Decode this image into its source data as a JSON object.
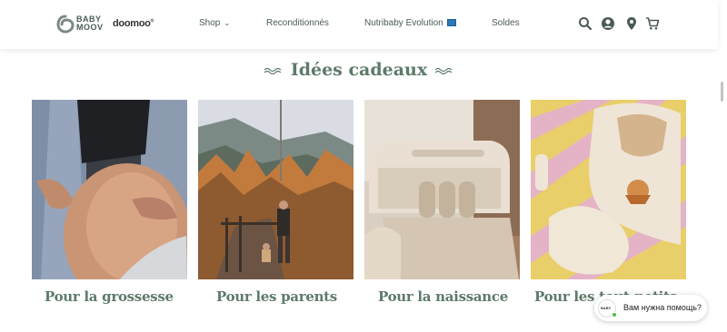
{
  "header": {
    "logo_text_line1": "BABY",
    "logo_text_line2": "MOOV",
    "doomoo_label": "doomoo",
    "nav": [
      {
        "label": "Shop"
      },
      {
        "label": "Reconditionnés"
      },
      {
        "label": "Nutribaby Evolution"
      },
      {
        "label": "Soldes"
      }
    ],
    "icons": [
      "search-icon",
      "account-icon",
      "location-pin-icon",
      "cart-icon"
    ]
  },
  "section": {
    "title": "Idées cadeaux"
  },
  "cards": [
    {
      "label": "Pour la grossesse"
    },
    {
      "label": "Pour les parents"
    },
    {
      "label": "Pour la naissance"
    },
    {
      "label": "Pour les tout-petits"
    }
  ],
  "chat": {
    "text": "Вам нужна помощь?"
  },
  "colors": {
    "accent": "#5e7a6a",
    "text": "#4a5a55",
    "online": "#47c044"
  }
}
